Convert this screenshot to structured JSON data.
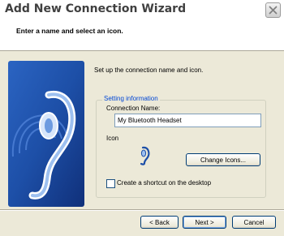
{
  "window": {
    "title": "Add New Connection Wizard",
    "close_icon": "close-icon"
  },
  "header": {
    "instruction": "Enter a name and select an icon."
  },
  "main": {
    "intro": "Set up the connection name and icon.",
    "setting_info": {
      "legend": "Setting information",
      "connection_name_label": "Connection Name:",
      "connection_name_value": "My Bluetooth Headset",
      "icon_label": "Icon",
      "icon": "headset-icon",
      "change_icons_label": "Change Icons...",
      "shortcut_label": "Create a shortcut on the desktop",
      "shortcut_checked": false
    },
    "illustration": "headset-illustration"
  },
  "footer": {
    "back_label": "< Back",
    "next_label": "Next >",
    "cancel_label": "Cancel"
  },
  "colors": {
    "accent": "#0046d5",
    "art_blue": "#1d4fa7",
    "window_bg": "#ece9d8"
  }
}
